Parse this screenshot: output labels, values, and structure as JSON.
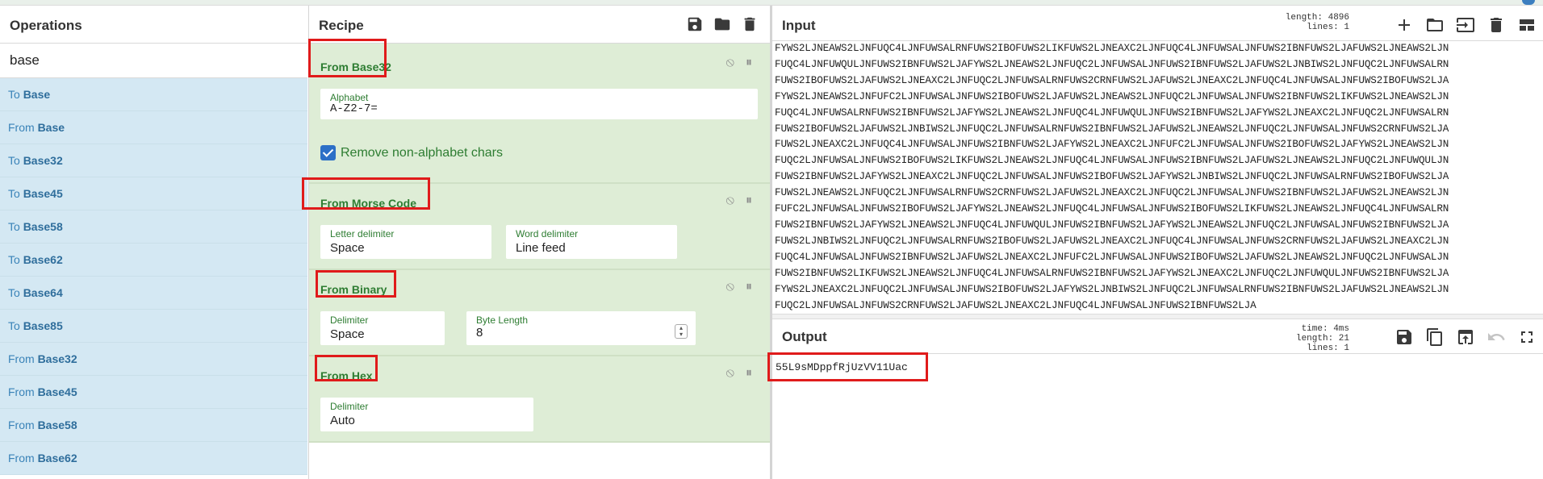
{
  "operations": {
    "title": "Operations",
    "search_value": "base",
    "items": [
      {
        "prefix": "To ",
        "match": "Base",
        "suffix": ""
      },
      {
        "prefix": "From ",
        "match": "Base",
        "suffix": ""
      },
      {
        "prefix": "To ",
        "match": "Base",
        "suffix": "32"
      },
      {
        "prefix": "To ",
        "match": "Base",
        "suffix": "45"
      },
      {
        "prefix": "To ",
        "match": "Base",
        "suffix": "58"
      },
      {
        "prefix": "To ",
        "match": "Base",
        "suffix": "62"
      },
      {
        "prefix": "To ",
        "match": "Base",
        "suffix": "64"
      },
      {
        "prefix": "To ",
        "match": "Base",
        "suffix": "85"
      },
      {
        "prefix": "From ",
        "match": "Base",
        "suffix": "32"
      },
      {
        "prefix": "From ",
        "match": "Base",
        "suffix": "45"
      },
      {
        "prefix": "From ",
        "match": "Base",
        "suffix": "58"
      },
      {
        "prefix": "From ",
        "match": "Base",
        "suffix": "62"
      }
    ]
  },
  "recipe": {
    "title": "Recipe",
    "header_icons": [
      "save-icon",
      "folder-icon",
      "trash-icon"
    ],
    "ops": [
      {
        "name": "From Base32",
        "fields": [
          {
            "label": "Alphabet",
            "value": "A-Z2-7="
          }
        ],
        "checkbox": {
          "label": "Remove non-alphabet chars",
          "checked": true
        }
      },
      {
        "name": "From Morse Code",
        "fields": [
          {
            "label": "Letter delimiter",
            "value": "Space"
          },
          {
            "label": "Word delimiter",
            "value": "Line feed"
          }
        ]
      },
      {
        "name": "From Binary",
        "fields": [
          {
            "label": "Delimiter",
            "value": "Space"
          },
          {
            "label": "Byte Length",
            "value": "8"
          }
        ]
      },
      {
        "name": "From Hex",
        "fields": [
          {
            "label": "Delimiter",
            "value": "Auto"
          }
        ]
      }
    ]
  },
  "input": {
    "title": "Input",
    "length_label": "length:",
    "length_value": "4896",
    "lines_label": "lines:",
    "lines_value": "1",
    "header_icons": [
      "plus-icon",
      "folder-icon",
      "import-icon",
      "trash-icon",
      "layout-icon"
    ],
    "text_lines": [
      "FYWS2LJNEAWS2LJNFUQC4LJNFUWSALRNFUWS2IBOFUWS2LIKFUWS2LJNEAXC2LJNFUQC4LJNFUWSALJNFUWS2IBNFUWS2LJAFUWS2LJNEAWS2LJN",
      "FUQC4LJNFUWQULJNFUWS2IBNFUWS2LJAFYWS2LJNEAWS2LJNFUQC2LJNFUWSALJNFUWS2IBNFUWS2LJAFUWS2LJNBIWS2LJNFUQC2LJNFUWSALRN",
      "FUWS2IBOFUWS2LJAFUWS2LJNEAXC2LJNFUQC2LJNFUWSALRNFUWS2CRNFUWS2LJAFUWS2LJNEAXC2LJNFUQC4LJNFUWSALJNFUWS2IBOFUWS2LJA",
      "FYWS2LJNEAWS2LJNFUFC2LJNFUWSALJNFUWS2IBOFUWS2LJAFUWS2LJNEAWS2LJNFUQC2LJNFUWSALJNFUWS2IBNFUWS2LIKFUWS2LJNEAWS2LJN",
      "FUQC4LJNFUWSALRNFUWS2IBNFUWS2LJAFYWS2LJNEAWS2LJNFUQC4LJNFUWQULJNFUWS2IBNFUWS2LJAFYWS2LJNEAXC2LJNFUQC2LJNFUWSALRN",
      "FUWS2IBOFUWS2LJAFUWS2LJNBIWS2LJNFUQC2LJNFUWSALRNFUWS2IBNFUWS2LJAFUWS2LJNEAWS2LJNFUQC2LJNFUWSALJNFUWS2CRNFUWS2LJA",
      "FUWS2LJNEAXC2LJNFUQC4LJNFUWSALJNFUWS2IBNFUWS2LJAFYWS2LJNEAXC2LJNFUFC2LJNFUWSALJNFUWS2IBOFUWS2LJAFYWS2LJNEAWS2LJN",
      "FUQC2LJNFUWSALJNFUWS2IBOFUWS2LIKFUWS2LJNEAWS2LJNFUQC4LJNFUWSALJNFUWS2IBNFUWS2LJAFUWS2LJNEAWS2LJNFUQC2LJNFUWQULJN",
      "FUWS2IBNFUWS2LJAFYWS2LJNEAXC2LJNFUQC2LJNFUWSALJNFUWS2IBOFUWS2LJAFYWS2LJNBIWS2LJNFUQC2LJNFUWSALRNFUWS2IBOFUWS2LJA",
      "FUWS2LJNEAWS2LJNFUQC2LJNFUWSALRNFUWS2CRNFUWS2LJAFUWS2LJNEAXC2LJNFUQC2LJNFUWSALJNFUWS2IBNFUWS2LJAFUWS2LJNEAWS2LJN",
      "FUFC2LJNFUWSALJNFUWS2IBOFUWS2LJAFYWS2LJNEAWS2LJNFUQC4LJNFUWSALJNFUWS2IBOFUWS2LIKFUWS2LJNEAWS2LJNFUQC4LJNFUWSALRN",
      "FUWS2IBNFUWS2LJAFYWS2LJNEAWS2LJNFUQC4LJNFUWQULJNFUWS2IBNFUWS2LJAFYWS2LJNEAWS2LJNFUQC2LJNFUWSALJNFUWS2IBNFUWS2LJA",
      "FUWS2LJNBIWS2LJNFUQC2LJNFUWSALRNFUWS2IBOFUWS2LJAFUWS2LJNEAXC2LJNFUQC4LJNFUWSALJNFUWS2CRNFUWS2LJAFUWS2LJNEAXC2LJN",
      "FUQC4LJNFUWSALJNFUWS2IBNFUWS2LJAFUWS2LJNEAXC2LJNFUFC2LJNFUWSALJNFUWS2IBOFUWS2LJAFUWS2LJNEAWS2LJNFUQC2LJNFUWSALJN",
      "FUWS2IBNFUWS2LIKFUWS2LJNEAWS2LJNFUQC4LJNFUWSALRNFUWS2IBNFUWS2LJAFYWS2LJNEAXC2LJNFUQC2LJNFUWQULJNFUWS2IBNFUWS2LJA",
      "FYWS2LJNEAXC2LJNFUQC2LJNFUWSALJNFUWS2IBOFUWS2LJAFYWS2LJNBIWS2LJNFUQC2LJNFUWSALRNFUWS2IBNFUWS2LJAFUWS2LJNEAWS2LJN",
      "FUQC2LJNFUWSALJNFUWS2CRNFUWS2LJAFUWS2LJNEAXC2LJNFUQC4LJNFUWSALJNFUWS2IBNFUWS2LJA"
    ]
  },
  "output": {
    "title": "Output",
    "time_label": "time:",
    "time_value": "4ms",
    "length_label": "length:",
    "length_value": "21",
    "lines_label": "lines:",
    "lines_value": "1",
    "header_icons": [
      "save-icon",
      "copy-icon",
      "replace-input-icon",
      "undo-icon",
      "fullscreen-icon"
    ],
    "text": "55L9sMDppfRjUzVV11Uac"
  },
  "colors": {
    "highlight": "#e01b1b",
    "op_bg": "#deedd6",
    "op_name": "#2e7d32",
    "ops_list_bg": "#d4e8f3"
  }
}
